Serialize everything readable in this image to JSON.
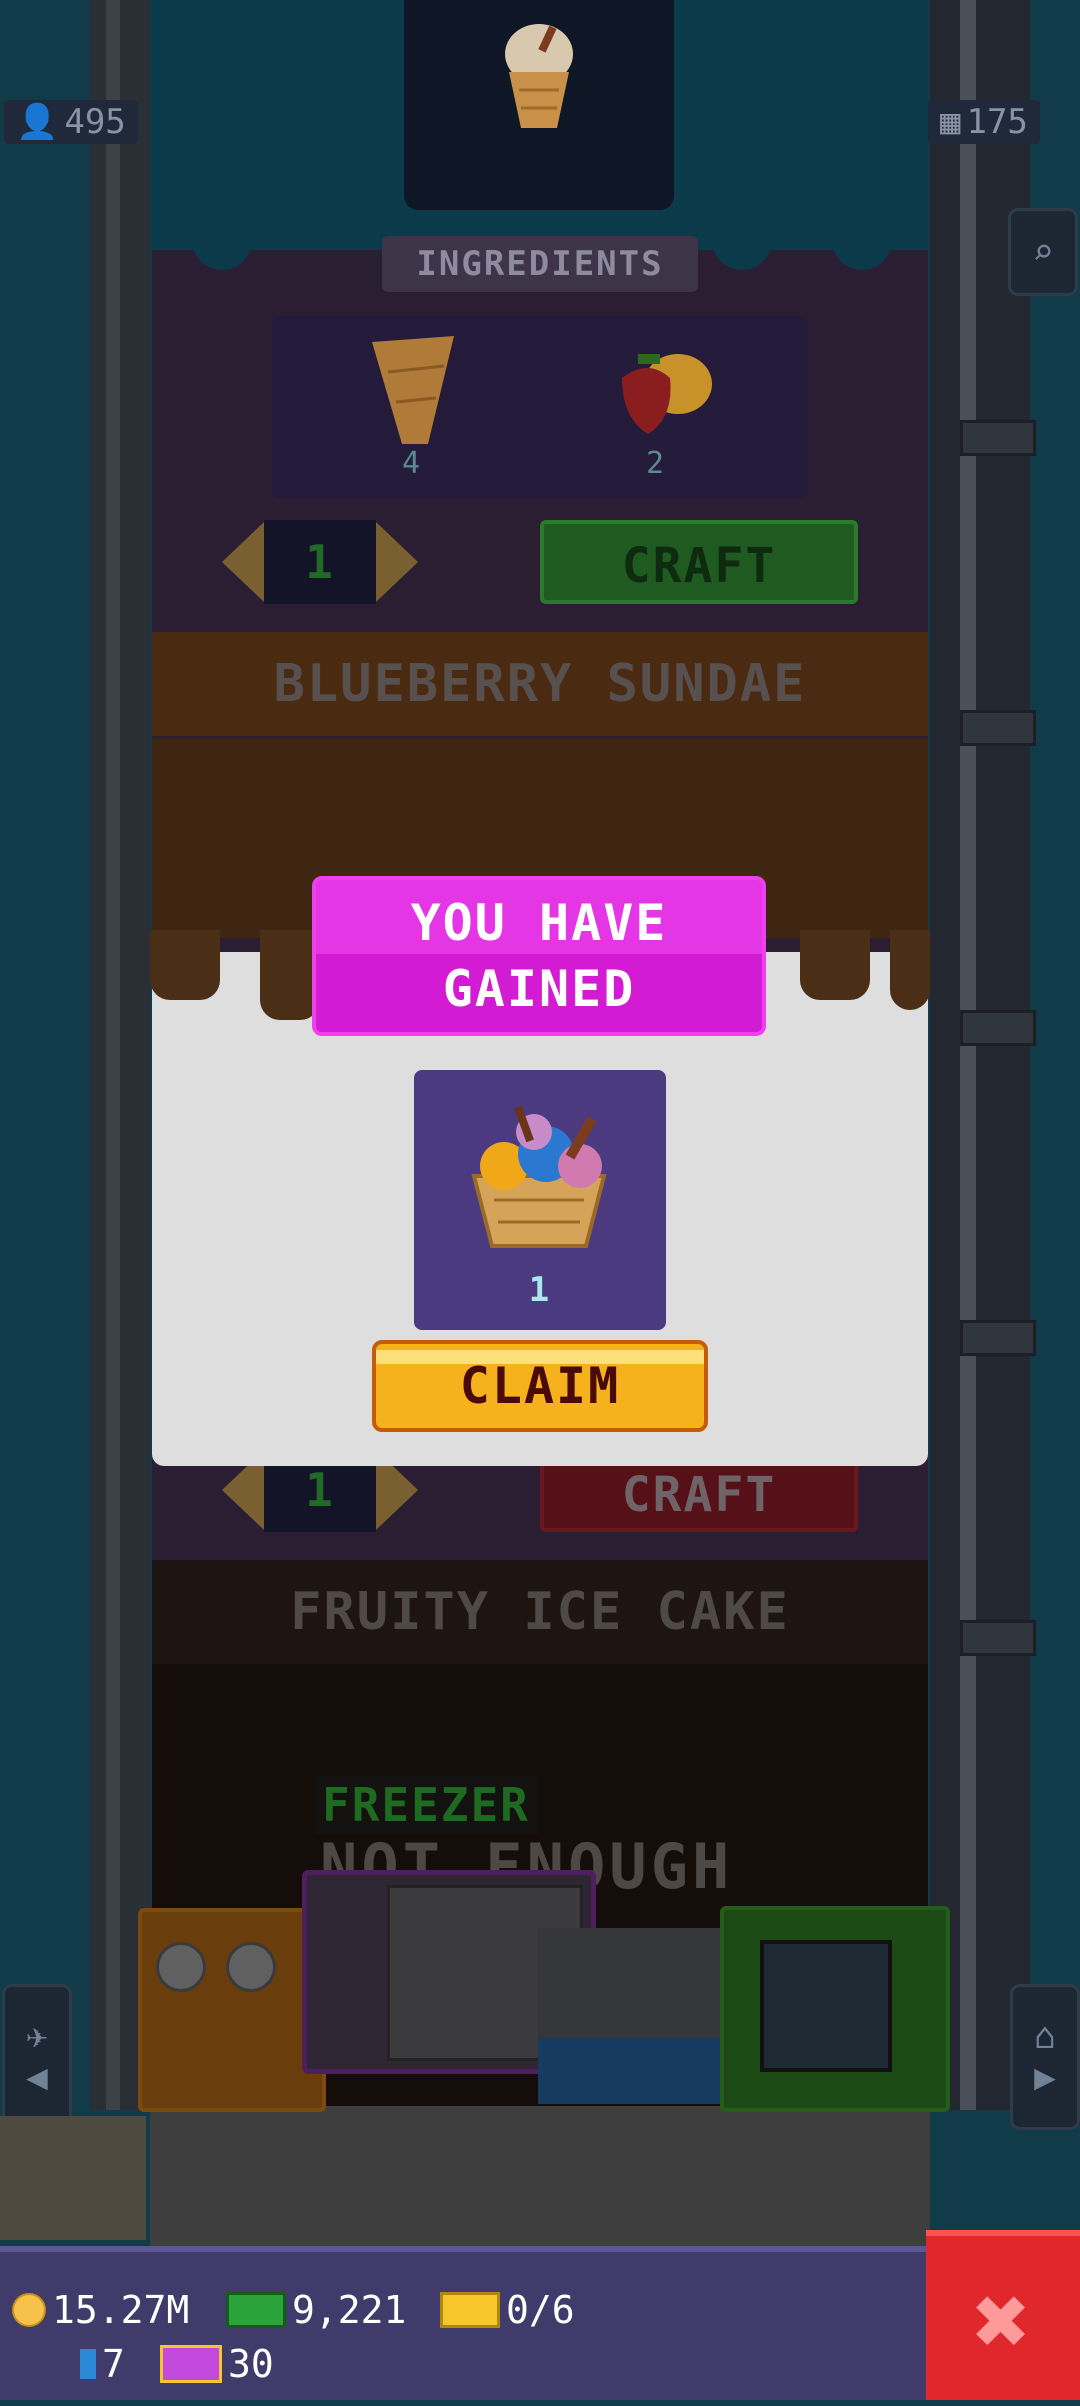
{
  "side": {
    "left_badge": "495",
    "right_badge": "175"
  },
  "recipe1": {
    "ingredients_label": "INGREDIENTS",
    "ingredient_counts": [
      "4",
      "2"
    ],
    "quantity": "1",
    "craft_label": "CRAFT"
  },
  "recipe2": {
    "title": "BLUEBERRY SUNDAE",
    "quantity": "1",
    "craft_label": "CRAFT"
  },
  "recipe3": {
    "title": "FRUITY ICE CAKE",
    "not_enough_text": "NOT ENOUGH"
  },
  "freezer_label": "FREEZER",
  "modal": {
    "title_line1": "YOU HAVE",
    "title_line2": "GAINED",
    "reward_count": "1",
    "claim_label": "CLAIM"
  },
  "bottom_bar": {
    "coins": "15.27M",
    "cash": "9,221",
    "tickets": "0/6",
    "gems": "7",
    "bux": "30"
  },
  "colors": {
    "banner": "#d21bd2",
    "claim": "#f5b21c",
    "close": "#e0282c",
    "bottom_bar": "#403b6a"
  },
  "icons": [
    "person-icon",
    "building-icon",
    "search-icon",
    "coin-icon",
    "cash-icon",
    "ticket-icon",
    "gem-icon",
    "bux-icon",
    "close-icon",
    "elevator-icon",
    "home-icon"
  ]
}
